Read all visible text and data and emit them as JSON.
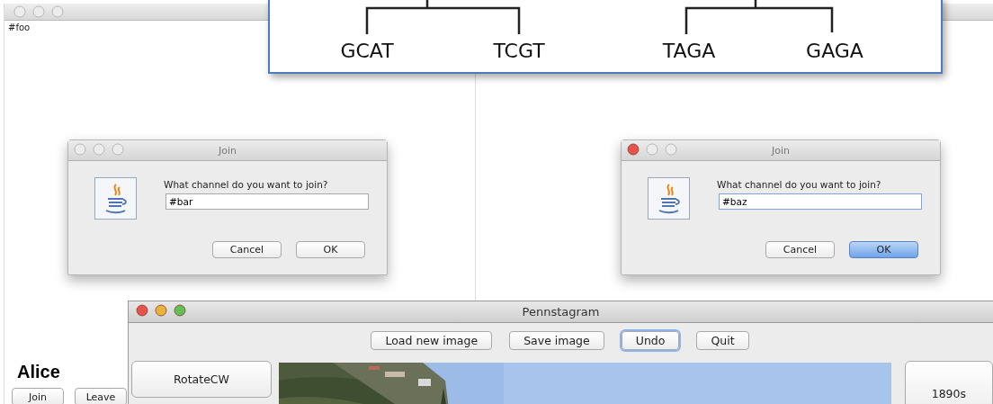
{
  "chat_windows": [
    {
      "active": false,
      "channel": "#foo",
      "user": "Alice",
      "buttons": [
        "Join",
        "Leave"
      ]
    }
  ],
  "tree": {
    "leaves": [
      "GCAT",
      "TCGT",
      "TAGA",
      "GAGA"
    ]
  },
  "dialogs": [
    {
      "active": false,
      "title": "Join",
      "prompt": "What channel do you want to join?",
      "value": "#bar",
      "buttons": [
        {
          "label": "Cancel",
          "default": false
        },
        {
          "label": "OK",
          "default": false
        }
      ]
    },
    {
      "active": true,
      "title": "Join",
      "prompt": "What channel do you want to join?",
      "value": "#baz",
      "buttons": [
        {
          "label": "Cancel",
          "default": false
        },
        {
          "label": "OK",
          "default": true
        }
      ]
    }
  ],
  "pennstagram": {
    "active": true,
    "title": "Pennstagram",
    "toolbar": [
      {
        "label": "Load new image",
        "focused": false
      },
      {
        "label": "Save image",
        "focused": false
      },
      {
        "label": "Undo",
        "focused": true
      },
      {
        "label": "Quit",
        "focused": false
      }
    ],
    "left_buttons": [
      "RotateCW"
    ],
    "right_buttons": [
      "1890s"
    ]
  }
}
